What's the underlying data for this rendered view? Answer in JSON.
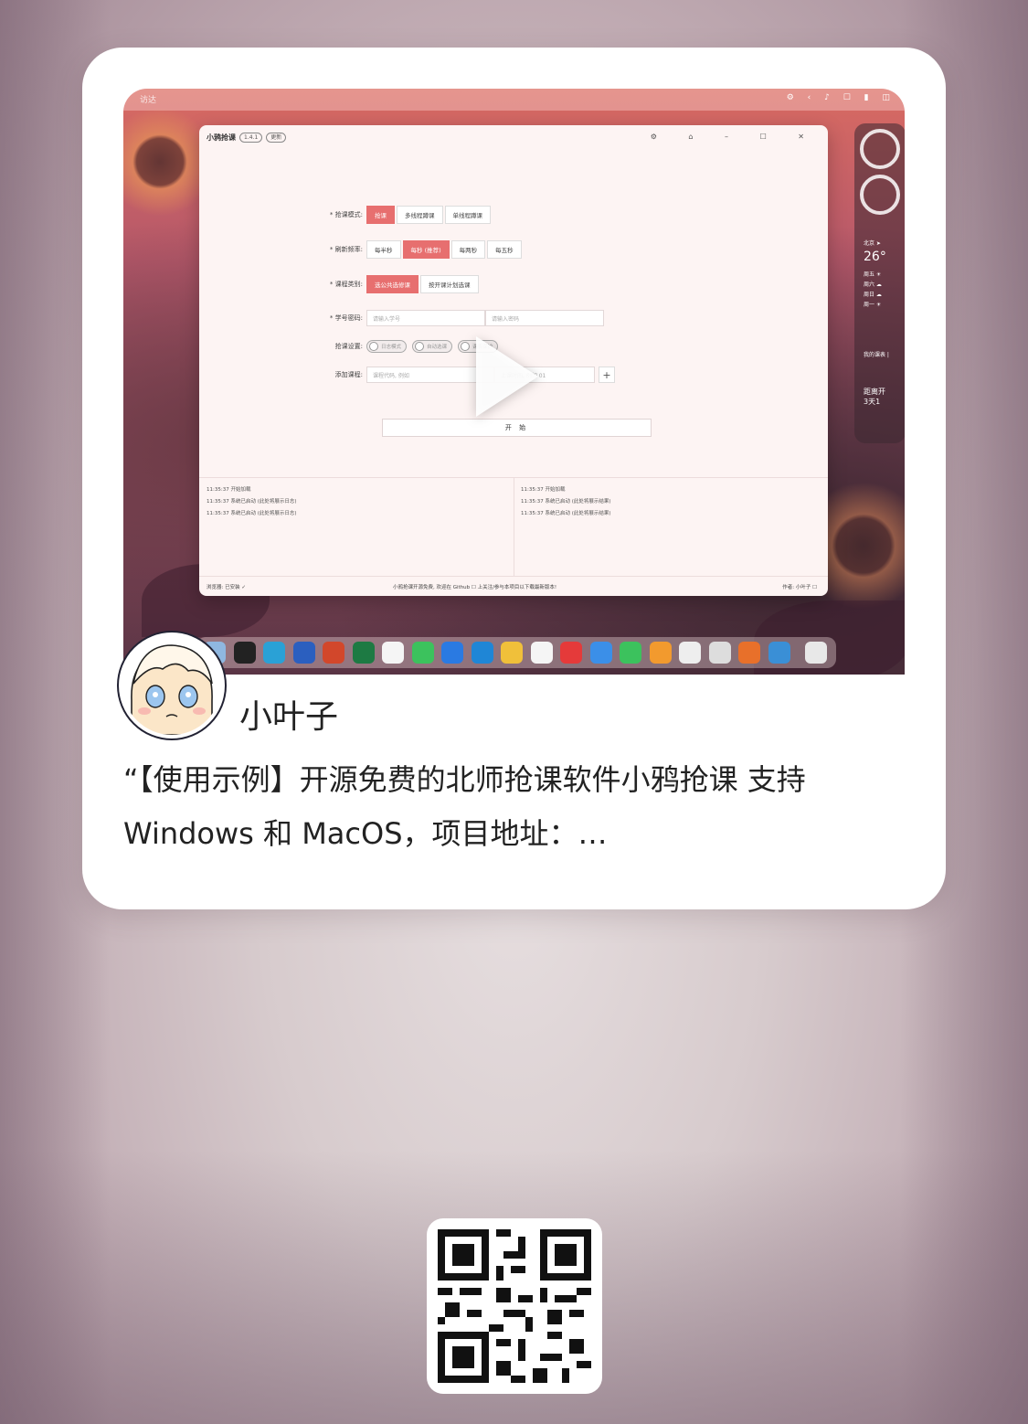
{
  "video": {
    "menubar_left": "访达",
    "app": {
      "title": "小鸦抢课",
      "version": "1.4.1",
      "update": "更新",
      "winctrls": "⚙ ⌂ – ☐ ✕",
      "rows": [
        {
          "label": "* 抢课模式:",
          "options": [
            "抢课",
            "多线程蹲课",
            "单线程蹲课"
          ],
          "active": 0
        },
        {
          "label": "* 刷新频率:",
          "options": [
            "每半秒",
            "每秒 (推荐)",
            "每两秒",
            "每五秒"
          ],
          "active": 1
        },
        {
          "label": "* 课程类别:",
          "options": [
            "选公共选修课",
            "按开课计划选课"
          ],
          "active": 0
        }
      ],
      "account_label": "* 学号密码:",
      "student_id_placeholder": "请输入学号",
      "password_placeholder": "请输入密码",
      "settings_label": "抢课设置:",
      "toggles": [
        "日志模式",
        "自动选课",
        "课表保护"
      ],
      "add_course_label": "添加课程:",
      "course_code_placeholder": "课程代码, 例如",
      "class_time_placeholder": "上课时间, 例如 01",
      "start_button": "开 始",
      "log_left": [
        "11:35:37  开始加载",
        "11:35:37  系统已启动 (此处将展示日志)",
        "11:35:37  系统已启动 (此处将展示日志)"
      ],
      "log_right": [
        "11:35:37  开始加载",
        "11:35:37  系统已启动 (此处将展示结果)",
        "11:35:37  系统已启动 (此处将展示结果)"
      ],
      "status_left": "浏览器: 已安装 ✓",
      "status_center": "小鸦抢课开源免费, 欢迎在 Github ☐ 上关注/参与本项目以下载最新版本!",
      "status_right": "作者: 小叶子 ☐"
    },
    "widgets": {
      "city": "北京 ➤",
      "temp": "26°",
      "forecast": [
        "周五 ☀",
        "周六 ☁",
        "周日 ☁",
        "周一 ☀"
      ],
      "note_title": "我的课表 |",
      "note_body": [
        "距离开",
        "3天1"
      ]
    }
  },
  "author": {
    "name": "小叶子"
  },
  "description": "“【使用示例】开源免费的北师抢课软件小鸦抢课 支持 Windows 和 MacOS，项目地址：https://github.com/Little-Leaves/XiaoYa-Course-Grabber",
  "colors": {
    "accent": "#e76f6f",
    "card_bg": "#ffffff",
    "text": "#222222"
  }
}
